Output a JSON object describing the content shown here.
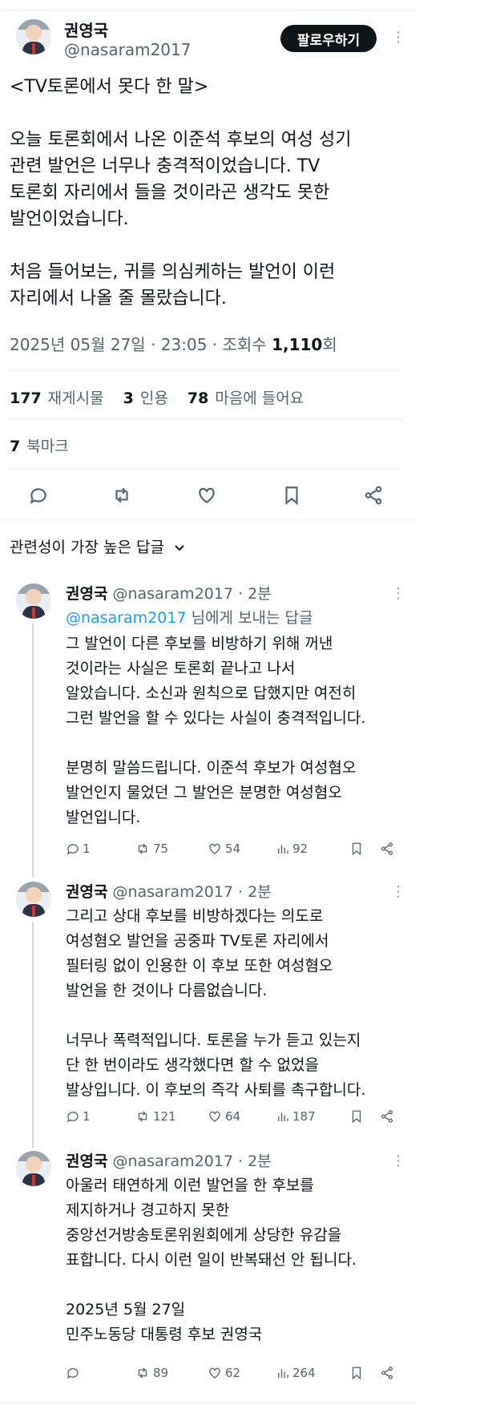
{
  "main_tweet": {
    "author_name": "권영국",
    "author_handle": "@nasaram2017",
    "follow_label": "팔로우하기",
    "text": "<TV토론에서 못다 한 말>\n\n오늘 토론회에서 나온 이준석 후보의 여성 성기\n관련 발언은 너무나 충격적이었습니다. TV\n토론회 자리에서 들을 것이라곤 생각도 못한\n발언이었습니다.\n\n처음 들어보는, 귀를 의심케하는 발언이 이런\n자리에서 나올 줄 몰랐습니다.",
    "timestamp": "2025년 05월 27일 · 23:05 · 조회수",
    "views": "1,110",
    "views_suffix": "회",
    "retweets_count": "177",
    "retweets_label": "재게시물",
    "quotes_count": "3",
    "quotes_label": "인용",
    "likes_count": "78",
    "likes_label": "마음에 들어요",
    "bookmarks_count": "7",
    "bookmarks_label": "북마크"
  },
  "sort_label": "관련성이 가장 높은 답글",
  "replies": [
    {
      "name": "권영국",
      "handle_time": "@nasaram2017 · 2분",
      "reply_to_link": "@nasaram2017",
      "reply_to_suffix": " 님에게 보내는 답글",
      "text": "그 발언이 다른 후보를 비방하기 위해 꺼낸\n것이라는 사실은 토론회 끝나고 나서\n알았습니다. 소신과 원칙으로 답했지만 여전히\n그런 발언을 할 수 있다는 사실이 충격적입니다.\n\n분명히 말씀드립니다. 이준석 후보가 여성혐오\n발언인지 물었던 그 발언은 분명한 여성혐오\n발언입니다.",
      "replies": "1",
      "retweets": "75",
      "likes": "54",
      "views": "92"
    },
    {
      "name": "권영국",
      "handle_time": "@nasaram2017 · 2분",
      "text": "그리고 상대 후보를 비방하겠다는 의도로\n여성혐오 발언을 공중파 TV토론 자리에서\n필터링 없이 인용한 이 후보 또한 여성혐오\n발언을 한 것이나 다름없습니다.\n\n너무나 폭력적입니다. 토론을 누가 듣고 있는지\n단 한 번이라도 생각했다면 할 수 없었을\n발상입니다. 이 후보의 즉각 사퇴를 촉구합니다.",
      "replies": "1",
      "retweets": "121",
      "likes": "64",
      "views": "187"
    },
    {
      "name": "권영국",
      "handle_time": "@nasaram2017 · 2분",
      "text": "아울러 태연하게 이런 발언을 한 후보를\n제지하거나 경고하지 못한\n중앙선거방송토론위원회에게 상당한 유감을\n표합니다. 다시 이런 일이 반복돼선 안 됩니다.\n\n2025년 5월 27일\n민주노동당 대통령 후보 권영국",
      "replies": "",
      "retweets": "89",
      "likes": "62",
      "views": "264"
    }
  ]
}
